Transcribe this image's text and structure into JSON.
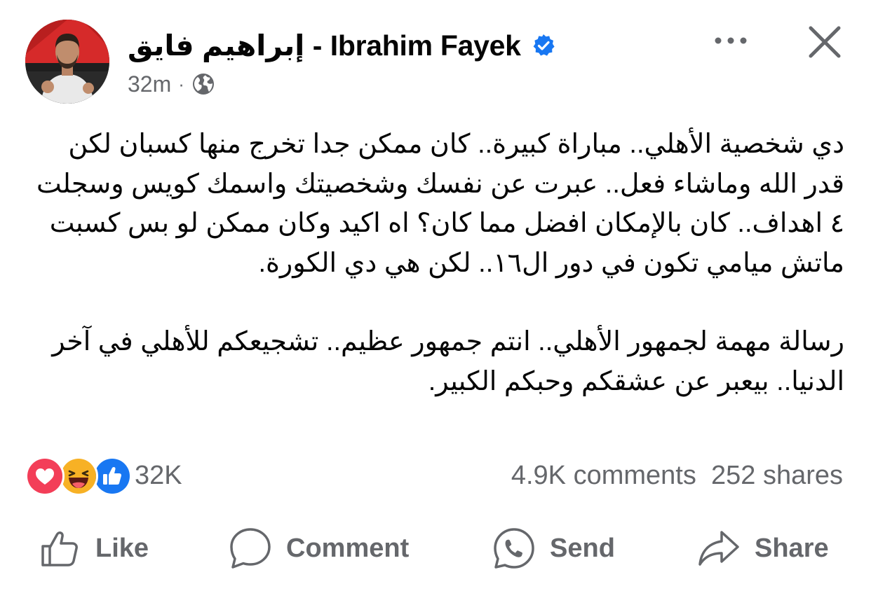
{
  "post": {
    "author": "إبراهيم  فايق - Ibrahim Fayek",
    "time": "32m",
    "separator": "·",
    "verified": true,
    "audience_icon": "globe-icon",
    "paragraphs": [
      "دي شخصية الأهلي.. مباراة كبيرة.. كان ممكن جدا تخرج منها كسبان لكن قدر الله وماشاء فعل.. عبرت عن نفسك وشخصيتك واسمك كويس وسجلت ٤ اهداف.. كان بالإمكان افضل مما كان؟ اه اكيد وكان ممكن لو بس كسبت ماتش ميامي تكون في دور ال١٦.. لكن هي دي الكورة.",
      "رسالة مهمة لجمهور الأهلي.. انتم جمهور عظيم.. تشجيعكم للأهلي في آخر الدنيا.. بيعبر عن عشقكم وحبكم الكبير."
    ]
  },
  "stats": {
    "reactions_count": "32K",
    "reaction_icons": [
      "love-icon",
      "haha-icon",
      "like-icon"
    ],
    "comments": "4.9K comments",
    "shares": "252 shares"
  },
  "actions": {
    "like": "Like",
    "comment": "Comment",
    "send": "Send",
    "share": "Share"
  },
  "colors": {
    "text": "#050505",
    "secondary": "#65676b",
    "verified_blue": "#1877f2",
    "love": "#f33e58",
    "haha": "#f7b125",
    "like": "#1877f2"
  }
}
